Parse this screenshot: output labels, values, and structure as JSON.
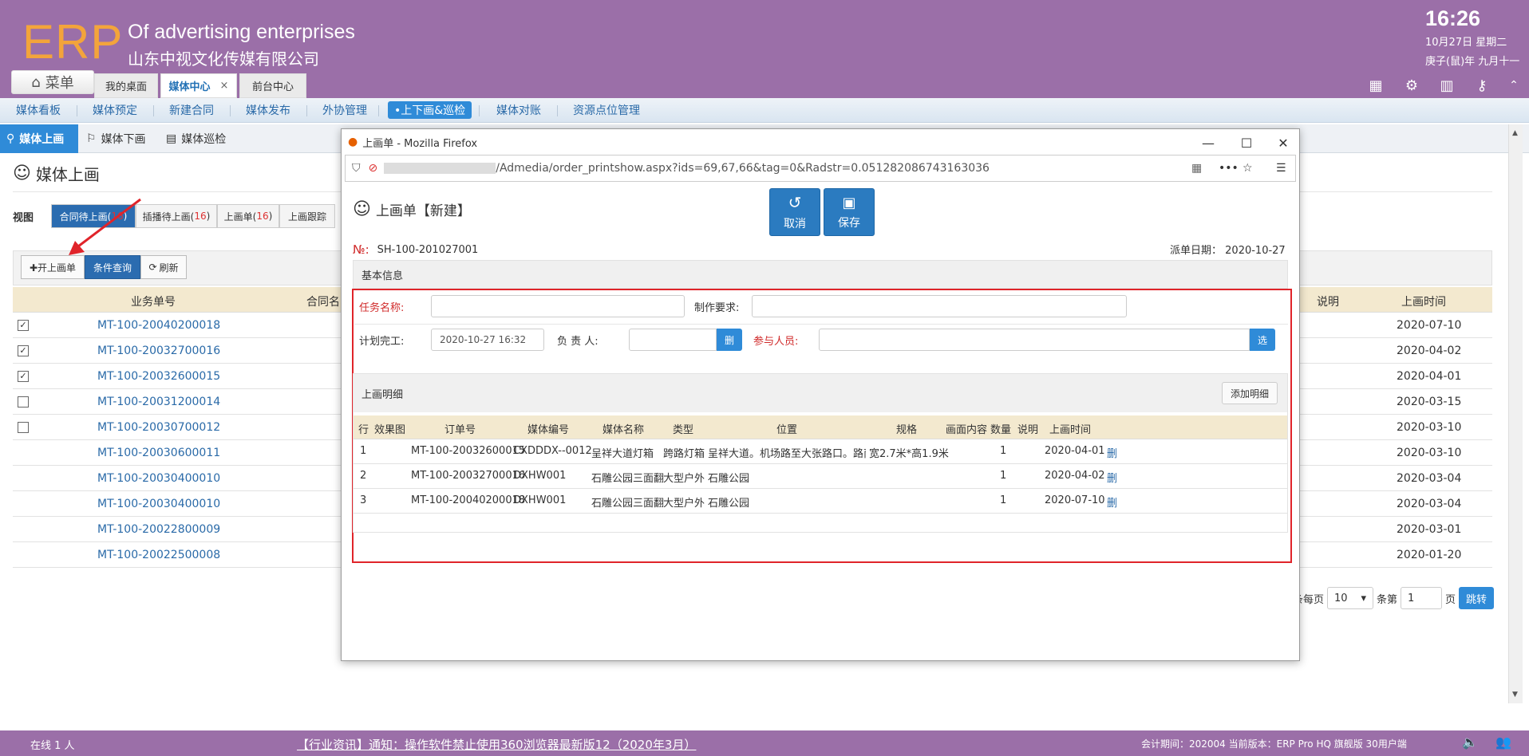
{
  "header": {
    "logo": "ERP",
    "company_en": "Of advertising enterprises",
    "company_cn": "山东中视文化传媒有限公司",
    "time": "16:26",
    "date_line1": "10月27日 星期二",
    "date_line2": "庚子(鼠)年 九月十一",
    "menu_label": "菜单",
    "tabs": [
      {
        "label": "我的桌面"
      },
      {
        "label": "媒体中心",
        "close": "×"
      },
      {
        "label": "前台中心"
      }
    ]
  },
  "nav": {
    "items": [
      "媒体看板",
      "媒体预定",
      "新建合同",
      "媒体发布",
      "外协管理",
      "•上下画&巡检",
      "媒体对账",
      "资源点位管理"
    ]
  },
  "subnav": {
    "items": [
      "媒体上画",
      "媒体下画",
      "媒体巡检"
    ]
  },
  "page": {
    "title": "媒体上画",
    "view_label": "视图",
    "view_tabs": [
      {
        "label": "合同待上画(",
        "count": "16",
        "close": ")"
      },
      {
        "label": "插播待上画(",
        "count": "16",
        "close": ")"
      },
      {
        "label": "上画单(",
        "count": "16",
        "close": ")"
      },
      {
        "label": "上画跟踪"
      }
    ],
    "toolbar": {
      "open_label": "✚开上画单",
      "query_label": "条件查询",
      "refresh_label": "刷新"
    },
    "grid": {
      "headers": [
        "业务单号",
        "合同名",
        "说明",
        "上画时间"
      ],
      "rows": [
        {
          "checkbox": "checked",
          "no": "MT-100-20040200018",
          "time": "2020-07-10"
        },
        {
          "checkbox": "checked",
          "no": "MT-100-20032700016",
          "time": "2020-04-02"
        },
        {
          "checkbox": "checked",
          "no": "MT-100-20032600015",
          "time": "2020-04-01"
        },
        {
          "checkbox": "empty",
          "no": "MT-100-20031200014",
          "time": "2020-03-15"
        },
        {
          "checkbox": "empty",
          "no": "MT-100-20030700012",
          "time": "2020-03-10"
        },
        {
          "checkbox": "none",
          "no": "MT-100-20030600011",
          "time": "2020-03-10"
        },
        {
          "checkbox": "none",
          "no": "MT-100-20030400010",
          "time": "2020-03-04"
        },
        {
          "checkbox": "none",
          "no": "MT-100-20030400010",
          "time": "2020-03-04"
        },
        {
          "checkbox": "none",
          "no": "MT-100-20022800009",
          "time": "2020-03-01"
        },
        {
          "checkbox": "none",
          "no": "MT-100-20022500008",
          "time": "2020-01-20"
        }
      ]
    },
    "pager": {
      "per_page_label": "条每页",
      "per_page_value": "10",
      "page_prefix": "条第",
      "page_value": "1",
      "page_suffix": "页",
      "go_label": "跳转"
    }
  },
  "footer": {
    "online": "在线  1  人",
    "notice": "【行业资讯】通知：操作软件禁止使用360浏览器最新版12（2020年3月）",
    "info": "会计期间：202004 当前版本：ERP Pro HQ 旗舰版 30用户端"
  },
  "modal": {
    "window_title": "上画单 - Mozilla Firefox",
    "url": "/Admedia/order_printshow.aspx?ids=69,67,66&tag=0&Radstr=0.051282086743163036",
    "title": "上画单【新建】",
    "cancel_label": "取消",
    "save_label": "保存",
    "no_label": "№:",
    "no_value": "SH-100-201027001",
    "dispatch_label": "派单日期：",
    "dispatch_value": "2020-10-27",
    "basic_info_label": "基本信息",
    "form": {
      "task_name_label": "任务名称:",
      "task_name_value": "",
      "requirement_label": "制作要求:",
      "requirement_value": "",
      "plan_finish_label": "计划完工:",
      "plan_finish_value": "2020-10-27 16:32",
      "owner_label": "负 责 人:",
      "owner_value": "",
      "owner_btn": "删",
      "participants_label": "参与人员:",
      "participants_value": "",
      "participants_btn": "选"
    },
    "detail": {
      "title": "上画明细",
      "add_label": "添加明细",
      "headers": [
        "行",
        "效果图",
        "订单号",
        "媒体编号",
        "媒体名称",
        "类型",
        "位置",
        "规格",
        "画面内容",
        "数量",
        "说明",
        "上画时间"
      ],
      "rows": [
        {
          "row": "1",
          "order": "MT-100-20032600015",
          "code": "CXDDDX--0012",
          "name": "呈祥大道灯箱",
          "type": "跨路灯箱",
          "location": "呈祥大道。机场路至大张路口。路南",
          "spec": "宽2.7米*高1.9米",
          "qty": "1",
          "time": "2020-04-01",
          "action": "删"
        },
        {
          "row": "2",
          "order": "MT-100-20032700016",
          "code": "DXHW001",
          "name": "石雕公园三面翻",
          "type": "大型户外",
          "location": "石雕公园",
          "spec": "",
          "qty": "1",
          "time": "2020-04-02",
          "action": "删"
        },
        {
          "row": "3",
          "order": "MT-100-20040200018",
          "code": "DXHW001",
          "name": "石雕公园三面翻",
          "type": "大型户外",
          "location": "石雕公园",
          "spec": "",
          "qty": "1",
          "time": "2020-07-10",
          "action": "删"
        }
      ]
    }
  },
  "colors": {
    "header_purple": "#9b6fa8",
    "logo_orange": "#f3a43b",
    "primary_blue": "#2f8bd8",
    "highlight_red": "#e0242a"
  }
}
